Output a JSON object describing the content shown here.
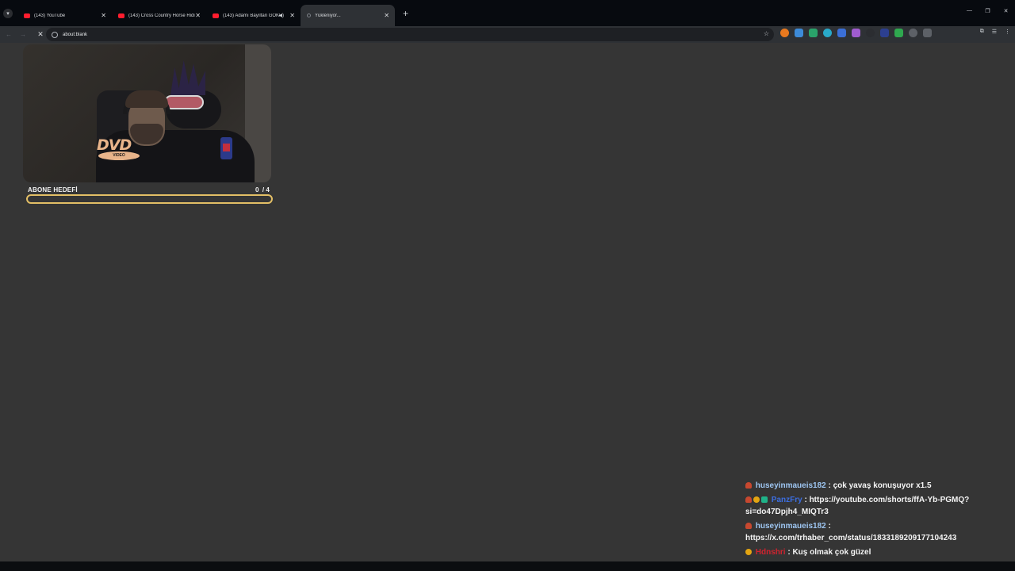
{
  "browser": {
    "tabs": [
      {
        "title": "(143) YouTube",
        "active": false,
        "audio": false
      },
      {
        "title": "(143) Cross Country Horse Ridi",
        "active": false,
        "audio": false
      },
      {
        "title": "(143) Adamı Bayıltan GÖKD",
        "active": false,
        "audio": true
      },
      {
        "title": "Yükleniyor...",
        "active": true,
        "audio": false
      }
    ],
    "address": "about:blank",
    "icons": {
      "tab_menu": "chevron-down-icon",
      "new_tab": "plus-icon",
      "back": "arrow-left-icon",
      "forward": "arrow-right-icon",
      "stop": "close-icon",
      "bookmark": "star-icon",
      "extensions": "puzzle-icon"
    },
    "extension_colors": [
      "#e8791f",
      "#3d8bd9",
      "#2aa36b",
      "#29a9c9",
      "#3b6fd6",
      "#a05ccf",
      "#2b2d31",
      "#2c3f8f",
      "#2fa84f",
      "#5d6167",
      "#5d6167"
    ]
  },
  "overlay": {
    "goal": {
      "label": "ABONE HEDEFİ",
      "current": 0,
      "target": 4,
      "count_text": "0  / 4",
      "bar_color": "#e3bf66"
    },
    "webcam_logo": {
      "text": "DVD",
      "sub": "VIDEO"
    }
  },
  "chat": [
    {
      "user": "huseyinmaueis182",
      "user_color": "#9ec6f2",
      "badges": [
        "fire"
      ],
      "text": " : çok yavaş konuşuyor x1.5"
    },
    {
      "user": "PanzFry",
      "user_color": "#3c6ee0",
      "badges": [
        "fire",
        "gold",
        "green"
      ],
      "text": " : https://youtube.com/shorts/ffA-Yb-PGMQ?si=do47Dpjh4_MIQTr3"
    },
    {
      "user": "huseyinmaueis182",
      "user_color": "#9ec6f2",
      "badges": [
        "fire"
      ],
      "text": " : https://x.com/trhaber_com/status/1833189209177104243"
    },
    {
      "user": "Hdnshri",
      "user_color": "#d2232f",
      "badges": [
        "gold"
      ],
      "text": " : Kuş olmak çok güzel"
    }
  ]
}
